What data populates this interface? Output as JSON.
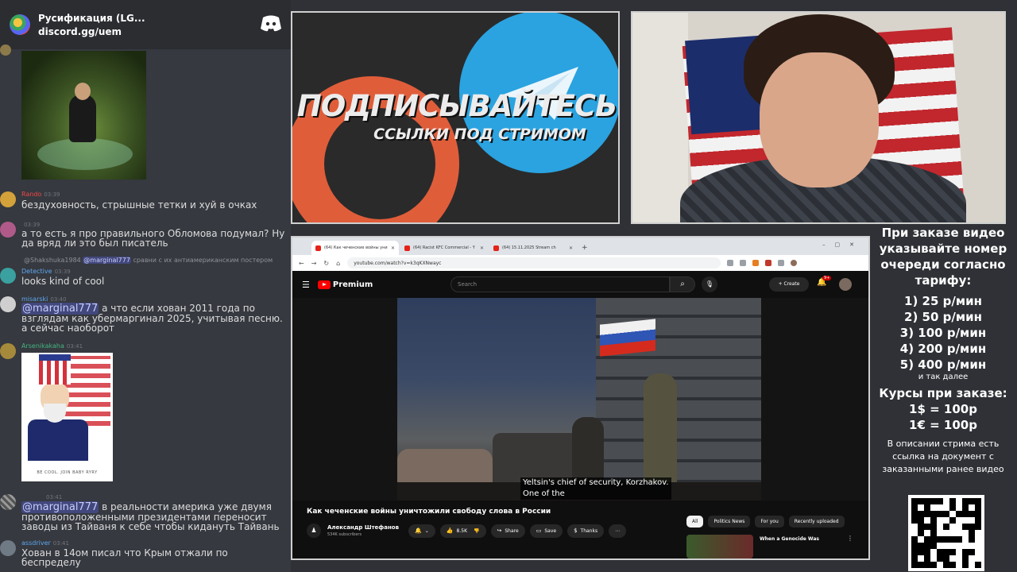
{
  "discord": {
    "server_name": "Русификация (LG...",
    "invite": "discord.gg/uem",
    "messages": [
      {
        "author": "Rando",
        "time": "03:39",
        "text": "бездуховность, стрышные тетки и хуй в очках",
        "color": "#f04747"
      },
      {
        "author": "",
        "time": "03:39",
        "text": "а то есть я про правильного Обломова подумал? Ну да вряд ли это был писатель",
        "color": "#b9bbbe"
      },
      {
        "author": "Detective",
        "time": "03:39",
        "text": "looks kind of cool",
        "color": "#5ea6f0",
        "reply_user": "@Shakshuka1984",
        "reply_mention": "@marginal777",
        "reply_text": "сравни с их антиамериканским постером"
      },
      {
        "author": "misarski",
        "time": "03:40",
        "mention": "@marginal777",
        "text": " а что если хован 2011 года по взглядам как убермаргинал 2025, учитывая песню. а сейчас наоборот",
        "color": "#5ea6f0"
      },
      {
        "author": "Arsenikakaha",
        "time": "03:41",
        "color": "#43b581",
        "image_caption": "BE COOL. JOIN BABY RYRY"
      },
      {
        "author": "",
        "time": "03:41",
        "mention": "@marginal777",
        "text": " в реальности америка уже двумя противоположенными президентами переносит заводы из Тайваня к себе чтобы кидануть Тайвань",
        "color": "#b9bbbe"
      },
      {
        "author": "assdriver",
        "time": "03:41",
        "text": "Хован в 14ом писал что Крым отжали по беспределу",
        "color": "#5ea6f0"
      }
    ]
  },
  "promo": {
    "title": "ПОДПИСЫВАЙТЕСЬ",
    "subtitle": "ССЫЛКИ ПОД СТРИМОМ"
  },
  "browser": {
    "tabs": [
      {
        "label": "(64) Как чеченские войны уни",
        "active": true
      },
      {
        "label": "(64) Racist KFC Commercial - Y",
        "active": false
      },
      {
        "label": "(64) 15.11.2025 Stream ch",
        "active": false
      }
    ],
    "url": "youtube.com/watch?v=k3qKXNwayc"
  },
  "youtube": {
    "brand": "Premium",
    "search_placeholder": "Search",
    "create_label": "Create",
    "notif_count": "9+",
    "subtitle_line1": "Yeltsin's chief of security, Korzhakov.",
    "subtitle_line2": "One of the",
    "video_title": "Как чеченские войны уничтожили свободу слова в России",
    "channel_name": "Александр Штефанов",
    "subscribers": "534K subscribers",
    "likes": "8.5K",
    "share_label": "Share",
    "save_label": "Save",
    "thanks_label": "Thanks",
    "chips": [
      "All",
      "Politics News",
      "For you",
      "Recently uploaded"
    ],
    "rec_title": "When a Genocide Was"
  },
  "donation": {
    "heading": "При заказе видео указывайте номер очереди согласно тарифу:",
    "rates": [
      "1) 25 р/мин",
      "2) 50 р/мин",
      "3) 100 р/мин",
      "4) 200 р/мин",
      "5) 400 р/мин"
    ],
    "etc": "и так далее",
    "courses_heading": "Курсы при заказе:",
    "course_usd": "1$ = 100р",
    "course_eur": "1€ = 100р",
    "description": "В описании стрима есть ссылка на документ с заказанными ранее видео"
  },
  "colors": {
    "discord_bg": "#36393f",
    "youtube_red": "#ff0000",
    "telegram_blue": "#2aa3e0",
    "boosty_orange": "#e05d3a"
  }
}
